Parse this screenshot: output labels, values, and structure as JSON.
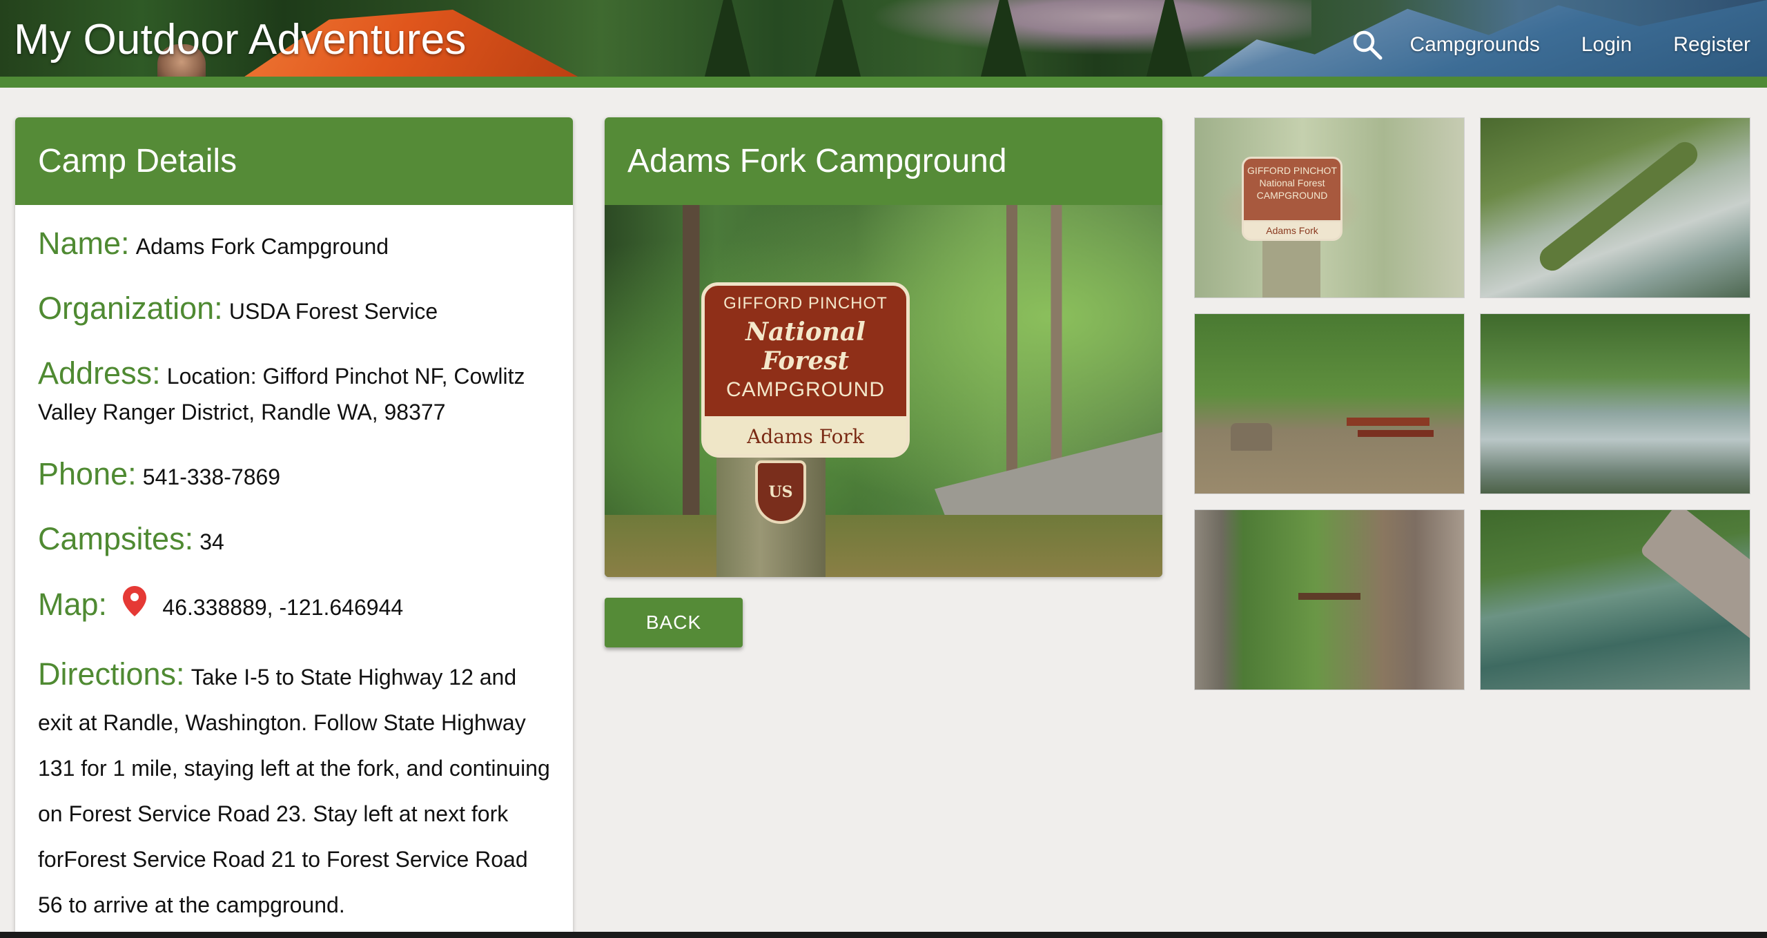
{
  "header": {
    "site_title": "My Outdoor Adventures",
    "nav": [
      {
        "label": "Campgrounds"
      },
      {
        "label": "Login"
      },
      {
        "label": "Register"
      }
    ],
    "search_icon": "search-icon"
  },
  "details": {
    "heading": "Camp Details",
    "fields": {
      "name": {
        "label": "Name:",
        "value": "Adams Fork Campground"
      },
      "organization": {
        "label": "Organization:",
        "value": "USDA Forest Service"
      },
      "address": {
        "label": "Address:",
        "value": "Location: Gifford Pinchot NF, Cowlitz Valley Ranger District, Randle WA, 98377"
      },
      "phone": {
        "label": "Phone:",
        "value": "541-338-7869"
      },
      "campsites": {
        "label": "Campsites:",
        "value": "34"
      },
      "map": {
        "label": "Map:",
        "value": "46.338889, -121.646944",
        "icon": "map-pin-icon"
      },
      "directions": {
        "label": "Directions:",
        "value": "Take I-5 to State Highway 12 and exit at Randle, Washington. Follow State Highway 131 for 1 mile, staying left at the fork, and continuing on Forest Service Road 23. Stay left at next fork forForest Service Road 21 to Forest Service Road 56 to arrive at the campground."
      }
    }
  },
  "campground": {
    "heading": "Adams Fork Campground",
    "sign": {
      "line1": "GIFFORD PINCHOT",
      "line2": "National Forest",
      "line3": "CAMPGROUND",
      "line4": "Adams Fork",
      "shield": "US"
    }
  },
  "back_button": {
    "label": "BACK"
  },
  "colors": {
    "accent_green": "#558b37",
    "label_green": "#4f8a32",
    "pin_red": "#e53935"
  }
}
